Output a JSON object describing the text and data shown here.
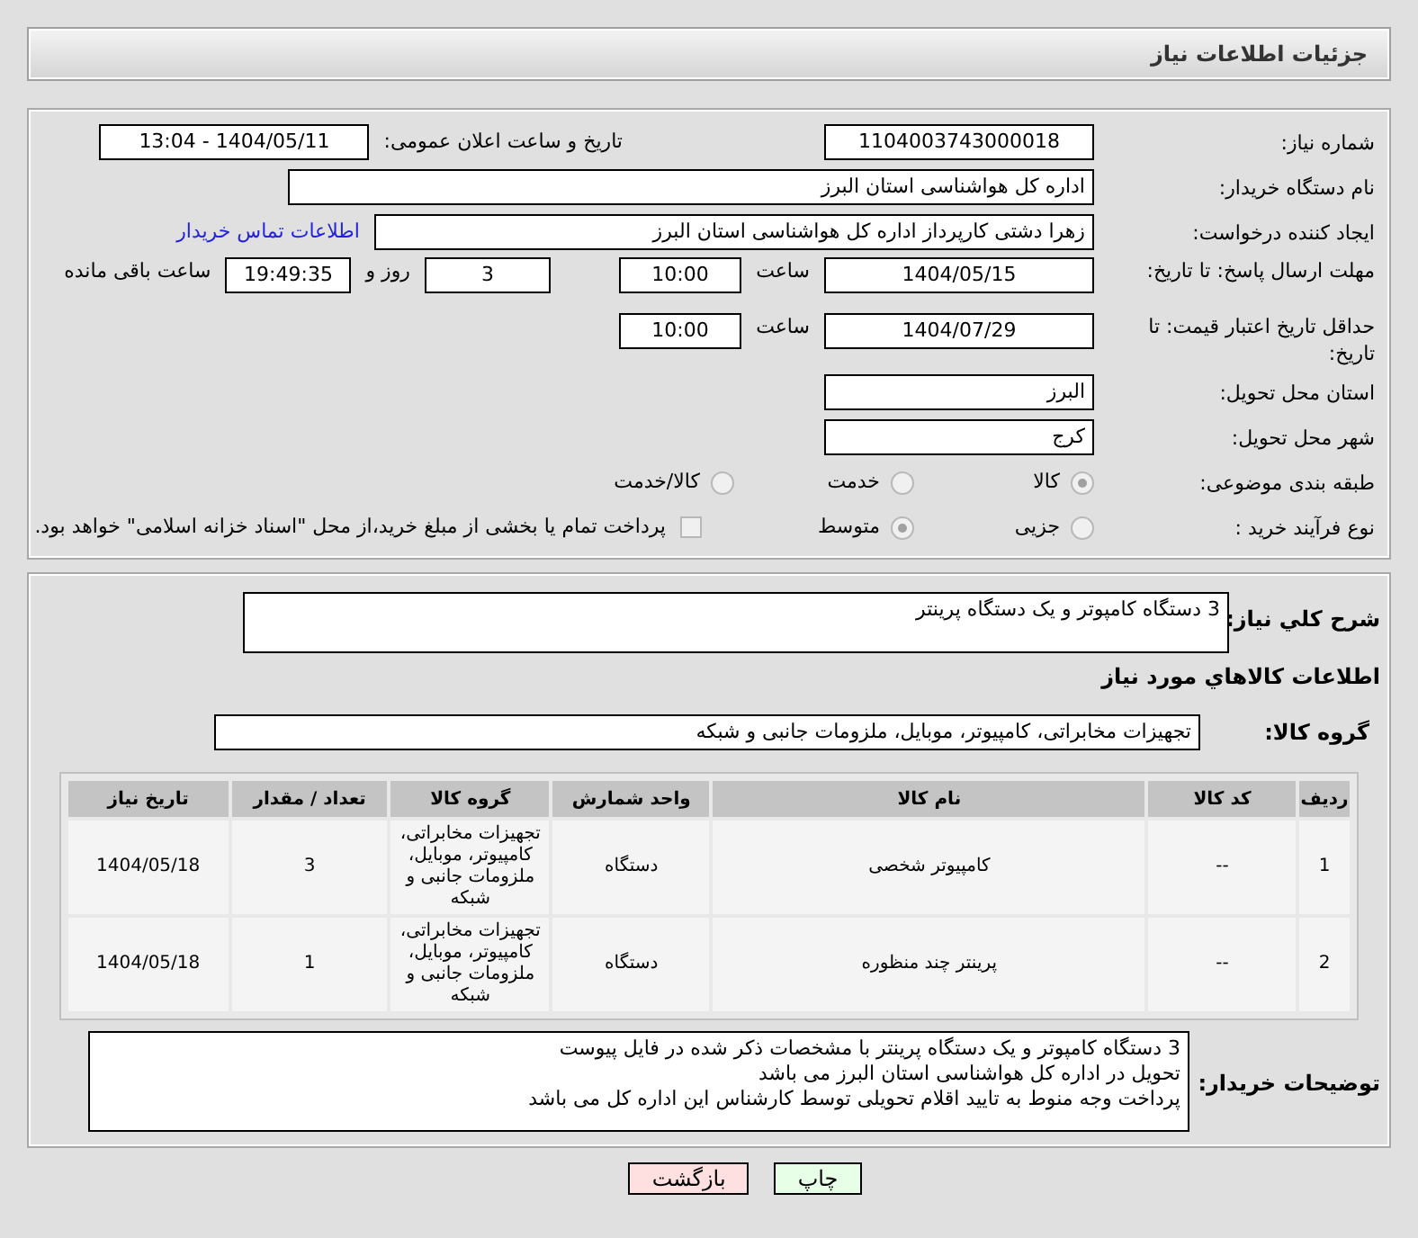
{
  "header": {
    "title": "جزئیات اطلاعات نیاز"
  },
  "need_number": {
    "label": "شماره نیاز:",
    "value": "1104003743000018"
  },
  "announce": {
    "label": "تاریخ و ساعت اعلان عمومی:",
    "value": "1404/05/11 - 13:04"
  },
  "buyer_org": {
    "label": "نام دستگاه خریدار:",
    "value": "اداره کل هواشناسی استان البرز"
  },
  "requester": {
    "label": "ایجاد کننده درخواست:",
    "value": "زهرا دشتی کارپرداز اداره کل هواشناسی استان البرز",
    "link": "اطلاعات تماس خریدار"
  },
  "deadline": {
    "label": "مهلت ارسال پاسخ: تا تاریخ:",
    "date": "1404/05/15",
    "time_label": "ساعت",
    "time": "10:00",
    "days": "3",
    "days_label": "روز و",
    "remaining": "19:49:35",
    "remaining_label": "ساعت باقی مانده"
  },
  "validity": {
    "label": "حداقل تاریخ اعتبار قیمت: تا تاریخ:",
    "date": "1404/07/29",
    "time_label": "ساعت",
    "time": "10:00"
  },
  "province": {
    "label": "استان محل تحویل:",
    "value": "البرز"
  },
  "city": {
    "label": "شهر محل تحویل:",
    "value": "کرج"
  },
  "category": {
    "label": "طبقه بندی موضوعی:",
    "options": [
      {
        "label": "کالا",
        "selected": true
      },
      {
        "label": "خدمت",
        "selected": false
      },
      {
        "label": "کالا/خدمت",
        "selected": false
      }
    ]
  },
  "process": {
    "label": "نوع فرآیند خرید :",
    "options": [
      {
        "label": "جزیی",
        "selected": false
      },
      {
        "label": "متوسط",
        "selected": true
      }
    ],
    "treasury": {
      "checked": false,
      "text": "پرداخت تمام یا بخشی از مبلغ خرید،از محل \"اسناد خزانه اسلامی\" خواهد بود."
    }
  },
  "description": {
    "label": "شرح کلي نياز:",
    "value": "3 دستگاه کامپوتر و یک دستگاه پرینتر"
  },
  "goods_heading": "اطلاعات کالاهاي مورد نياز",
  "goods_group": {
    "label": "گروه کالا:",
    "value": "تجهیزات مخابراتی، کامپیوتر، موبایل، ملزومات جانبی و شبکه"
  },
  "table": {
    "columns": [
      "ردیف",
      "کد کالا",
      "نام کالا",
      "واحد شمارش",
      "گروه کالا",
      "تعداد / مقدار",
      "تاریخ نیاز"
    ],
    "rows": [
      [
        "1",
        "--",
        "کامپیوتر شخصی",
        "دستگاه",
        "تجهیزات مخابراتی، کامپیوتر، موبایل، ملزومات جانبی و شبکه",
        "3",
        "1404/05/18"
      ],
      [
        "2",
        "--",
        "پرینتر چند منظوره",
        "دستگاه",
        "تجهیزات مخابراتی، کامپیوتر، موبایل، ملزومات جانبی و شبکه",
        "1",
        "1404/05/18"
      ]
    ]
  },
  "buyer_notes": {
    "label": "توضیحات خریدار:",
    "lines": [
      "3 دستگاه کامپوتر و یک دستگاه پرینتر  با مشخصات ذکر شده در فایل پیوست",
      "تحویل در اداره کل هواشناسی استان البرز می باشد",
      "پرداخت وجه منوط به تایید اقلام تحویلی توسط کارشناس این اداره کل می باشد"
    ]
  },
  "buttons": [
    {
      "label": "چاپ",
      "kind": "print"
    },
    {
      "label": "بازگشت",
      "kind": "back"
    }
  ]
}
